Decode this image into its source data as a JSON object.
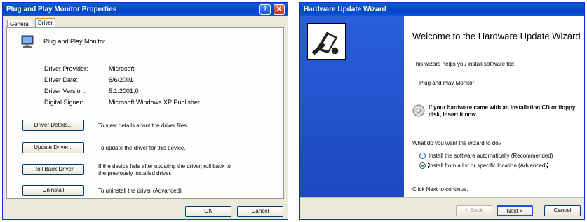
{
  "properties": {
    "title": "Plug and Play Monitor Properties",
    "help_glyph": "?",
    "close_glyph": "✕",
    "tabs": [
      "General",
      "Driver"
    ],
    "device_name": "Plug and Play Monitor",
    "info": [
      {
        "label": "Driver Provider:",
        "value": "Microsoft"
      },
      {
        "label": "Driver Date:",
        "value": "6/6/2001"
      },
      {
        "label": "Driver Version:",
        "value": "5.1.2001.0"
      },
      {
        "label": "Digital Signer:",
        "value": "Microsoft Windows XP Publisher"
      }
    ],
    "actions": [
      {
        "label": "Driver Details...",
        "desc": "To view details about the driver files."
      },
      {
        "label": "Update Driver...",
        "desc": "To update the driver for this device."
      },
      {
        "label": "Roll Back Driver",
        "desc": "If the device fails after updating the driver, roll back to the previously installed driver."
      },
      {
        "label": "Uninstall",
        "desc": "To uninstall the driver (Advanced)."
      }
    ],
    "ok_label": "OK",
    "cancel_label": "Cancel"
  },
  "wizard": {
    "title": "Hardware Update Wizard",
    "heading": "Welcome to the Hardware Update Wizard",
    "intro": "This wizard helps you install software for:",
    "device": "Plug and Play Monitor",
    "cd_hint": "If your hardware came with an installation CD or floppy disk, insert it now.",
    "question": "What do you want the wizard to do?",
    "options": [
      {
        "label": "Install the software automatically (Recommended)",
        "selected": false
      },
      {
        "label": "Install from a list or specific location (Advanced)",
        "selected": true
      }
    ],
    "continue_text": "Click Next to continue.",
    "back_label": "< Back",
    "next_label": "Next >",
    "cancel_label": "Cancel"
  },
  "colors": {
    "titlebar": "#0541c8",
    "wizard_side": "#1d48c0"
  }
}
